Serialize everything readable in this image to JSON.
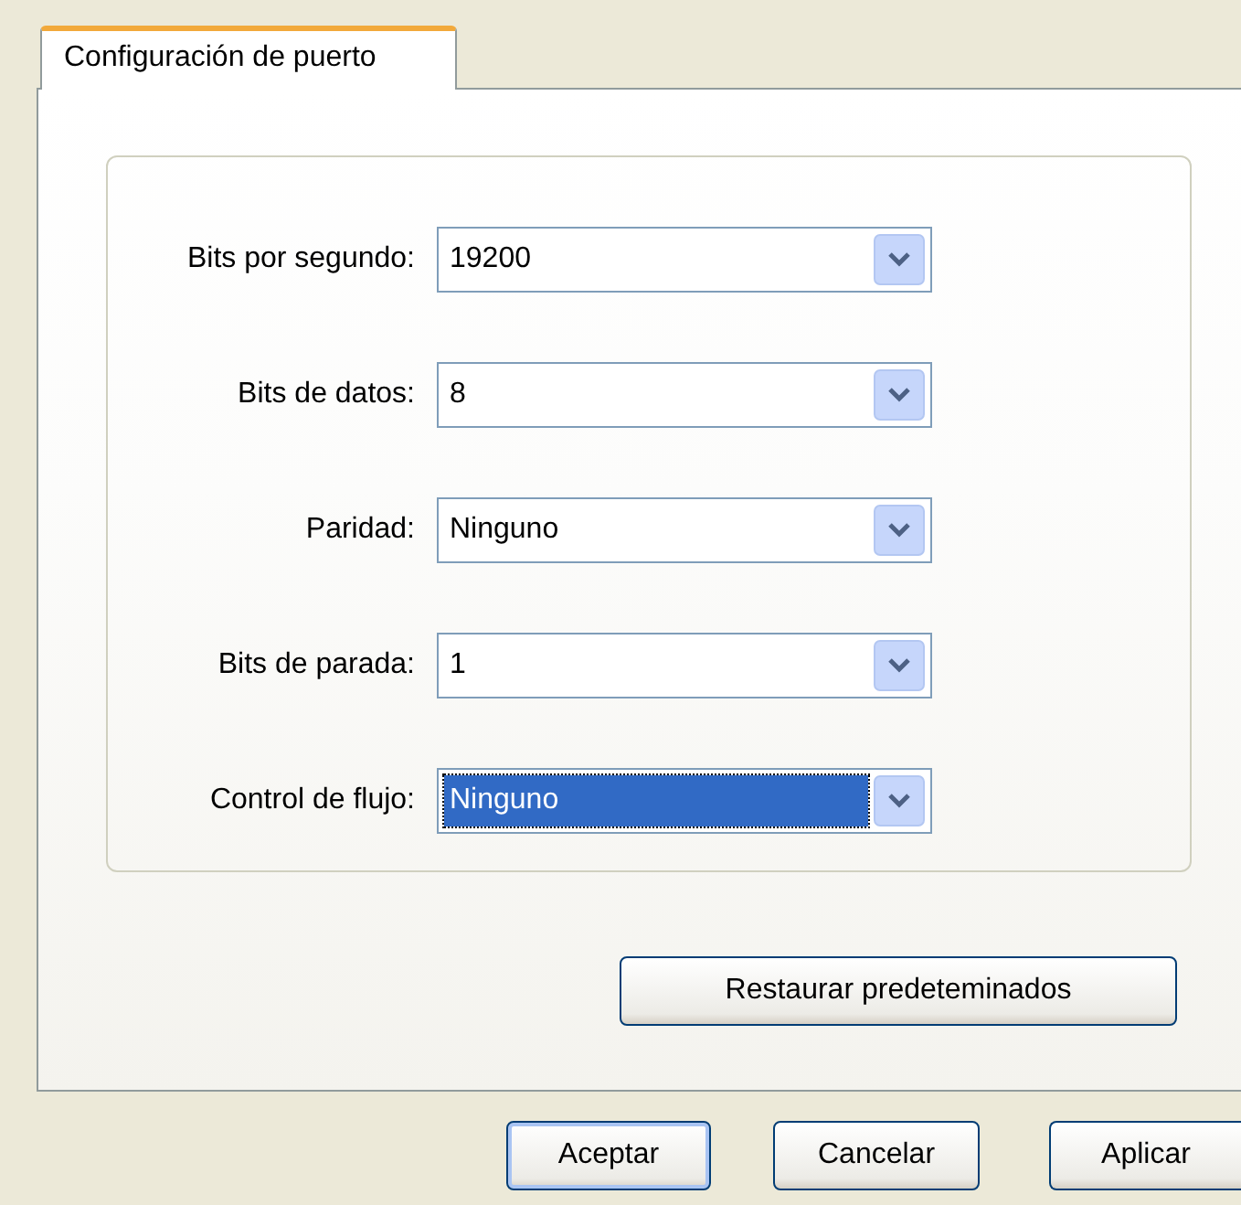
{
  "tabs": [
    {
      "label": "Configuración de puerto",
      "selected": true
    }
  ],
  "fields": [
    {
      "label": "Bits por segundo:",
      "value": "19200",
      "selected": false
    },
    {
      "label": "Bits de datos:",
      "value": "8",
      "selected": false
    },
    {
      "label": "Paridad:",
      "value": "Ninguno",
      "selected": false
    },
    {
      "label": "Bits de parada:",
      "value": "1",
      "selected": false
    },
    {
      "label": "Control de flujo:",
      "value": "Ninguno",
      "selected": true
    }
  ],
  "restore_button": "Restaurar predeteminados",
  "buttons": [
    {
      "label": "Aceptar",
      "default": true
    },
    {
      "label": "Cancelar",
      "default": false
    },
    {
      "label": "Aplicar",
      "default": false
    }
  ]
}
